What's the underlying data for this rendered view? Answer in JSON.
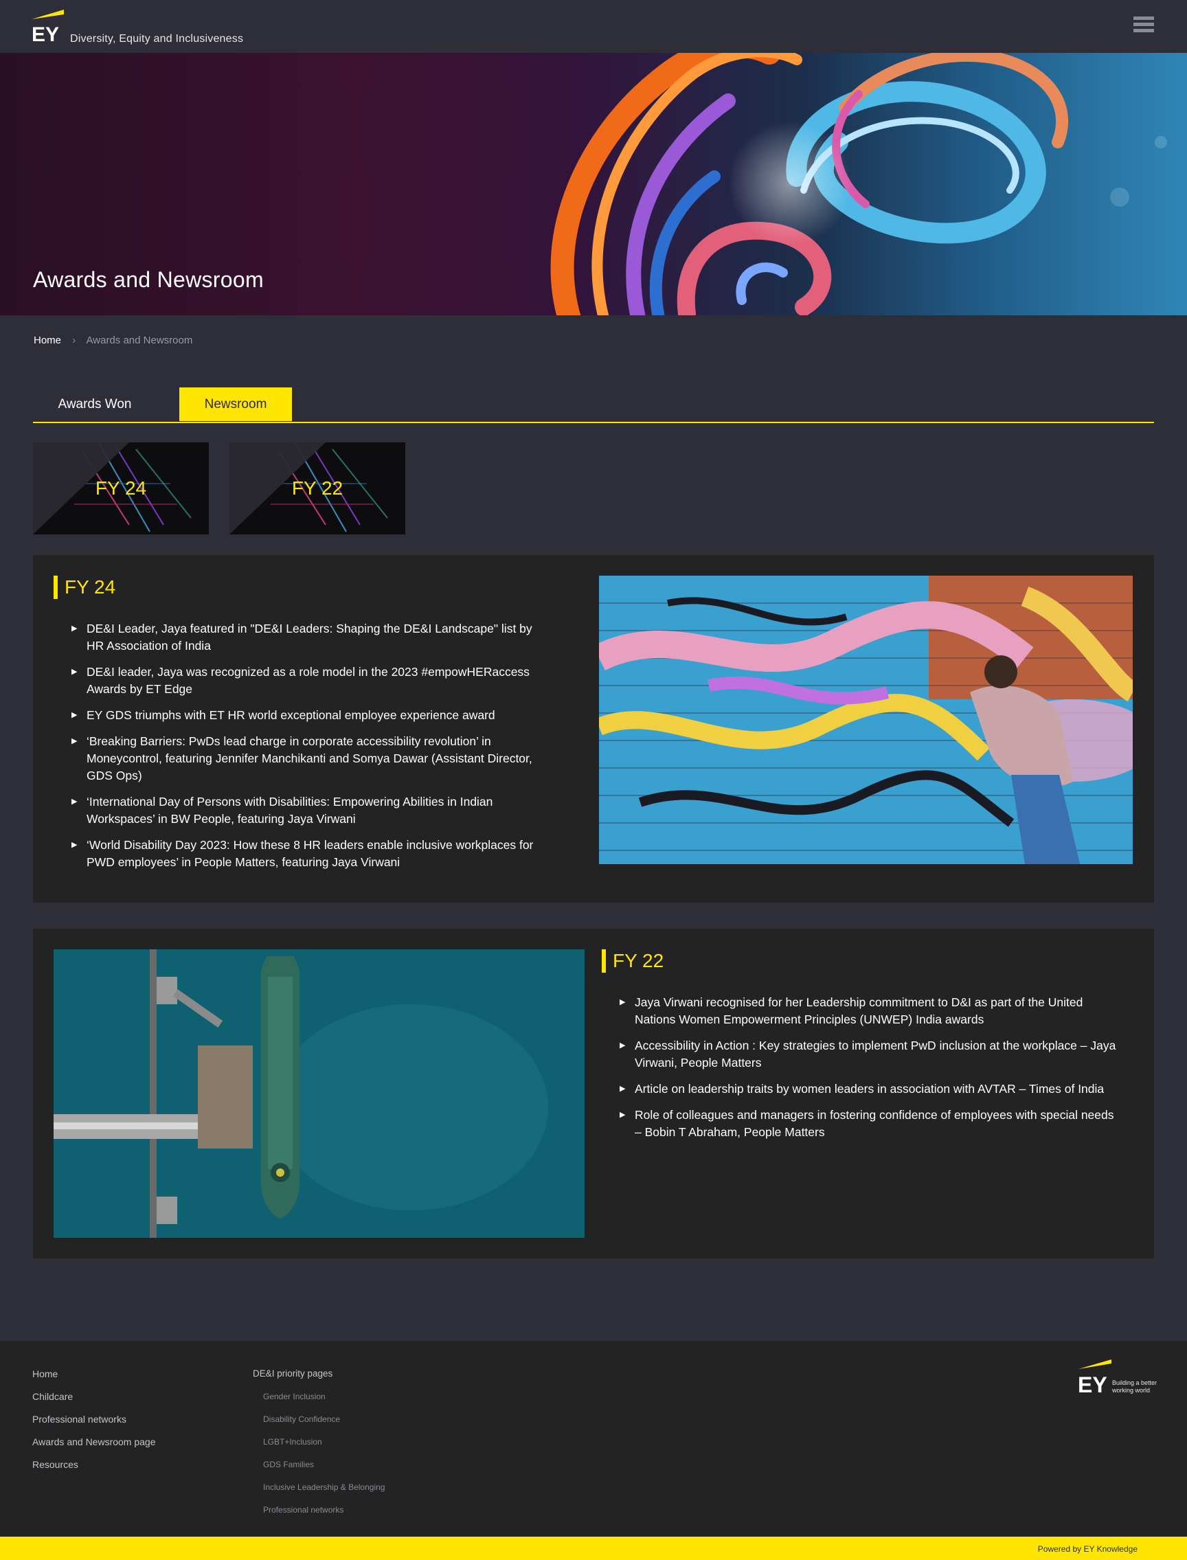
{
  "header": {
    "logo_text": "EY",
    "site_name": "Diversity, Equity and Inclusiveness",
    "menu_icon": "hamburger-menu-icon"
  },
  "hero": {
    "title": "Awards and Newsroom"
  },
  "breadcrumb": {
    "home": "Home",
    "separator": "›",
    "current": "Awards and Newsroom"
  },
  "tabs": [
    {
      "label": "Awards Won",
      "active": false
    },
    {
      "label": "Newsroom",
      "active": true
    }
  ],
  "year_cards": [
    {
      "label": "FY 24"
    },
    {
      "label": "FY 22"
    }
  ],
  "sections": {
    "fy24": {
      "title": "FY 24",
      "items": [
        "DE&I Leader, Jaya featured in \"DE&I Leaders: Shaping the DE&I Landscape\" list by HR Association of India",
        "DE&I leader, Jaya was recognized as a role model in the 2023 #empowHERaccess Awards by ET Edge",
        "EY GDS triumphs with ET HR world exceptional employee experience award",
        "‘Breaking Barriers: PwDs lead charge in corporate accessibility revolution’ in Moneycontrol, featuring Jennifer Manchikanti and Somya Dawar (Assistant Director, GDS Ops)",
        "‘International Day of Persons with Disabilities: Empowering Abilities in Indian Workspaces’ in BW People, featuring Jaya Virwani",
        "‘World Disability Day 2023: How these 8 HR leaders enable inclusive workplaces for PWD employees’ in People Matters, featuring Jaya Virwani"
      ]
    },
    "fy22": {
      "title": "FY 22",
      "items": [
        "Jaya Virwani recognised for her Leadership commitment to D&I as part of the United Nations Women Empowerment Principles (UNWEP) India awards",
        "Accessibility in Action : Key strategies to implement PwD inclusion at the workplace – Jaya Virwani, People Matters",
        "Article on leadership traits by women leaders in association with AVTAR – Times of India",
        "Role of colleagues and managers in fostering confidence of employees with special needs – Bobin T Abraham, People Matters"
      ]
    }
  },
  "footer": {
    "links": [
      "Home",
      "Childcare",
      "Professional networks",
      "Awards and Newsroom page",
      "Resources"
    ],
    "priority_heading": "DE&I priority pages",
    "priority_links": [
      "Gender Inclusion",
      "Disability Confidence",
      "LGBT+Inclusion",
      "GDS Families",
      "Inclusive Leadership & Belonging",
      "Professional networks"
    ],
    "logo_text": "EY",
    "tagline_line1": "Building a better",
    "tagline_line2": "working world",
    "powered_by": "Powered by EY Knowledge"
  },
  "colors": {
    "accent": "#ffe600",
    "background": "#2e2e38",
    "panel": "#232323"
  }
}
